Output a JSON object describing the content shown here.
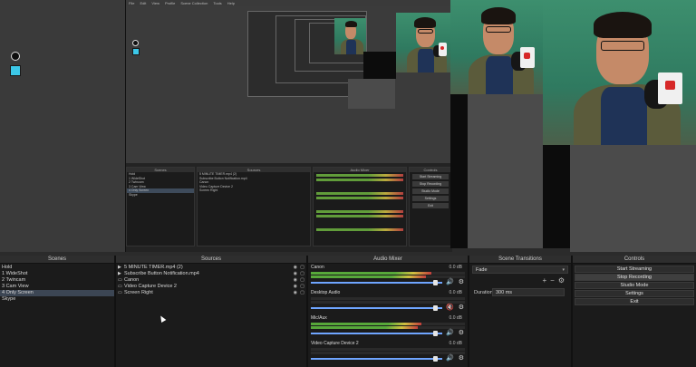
{
  "nested_menu": [
    "File",
    "Edit",
    "View",
    "Profile",
    "Scene Collection",
    "Tools",
    "Help"
  ],
  "nested_panels": {
    "scenes_title": "Scenes",
    "scenes": [
      "Hold",
      "1 WideShot",
      "2 Twincam",
      "3 Cam View",
      "4 Only Screen",
      "Skype"
    ],
    "sources_title": "Sources",
    "sources": [
      "5 MINUTE TIMER.mp4 (2)",
      "Subscribe Button Notification.mp4",
      "Canon",
      "Video Capture Device 2",
      "Screen Right"
    ],
    "mixer_title": "Audio Mixer",
    "transitions_title": "Scene Transitions",
    "controls_title": "Controls",
    "controls": [
      "Start Streaming",
      "Stop Recording",
      "Studio Mode",
      "Settings",
      "Exit"
    ]
  },
  "scenes_dock": {
    "title": "Scenes",
    "items": [
      "Hold",
      "1 WideShot",
      "2 Twincam",
      "3 Cam View",
      "4 Only Screen",
      "Skype"
    ],
    "selected_index": 4
  },
  "sources_dock": {
    "title": "Sources",
    "items": [
      {
        "label": "5 MINUTE TIMER.mp4 (2)",
        "icon": "play-icon"
      },
      {
        "label": "Subscribe Button Notification.mp4",
        "icon": "play-icon"
      },
      {
        "label": "Canon",
        "icon": "camera-icon"
      },
      {
        "label": "Video Capture Device 2",
        "icon": "camera-icon"
      },
      {
        "label": "Screen Right",
        "icon": "monitor-icon"
      }
    ]
  },
  "mixer_dock": {
    "title": "Audio Mixer",
    "channels": [
      {
        "name": "Canon",
        "db": "0.0 dB",
        "level": 0.78,
        "volume": 0.95,
        "muted": false
      },
      {
        "name": "Desktop Audio",
        "db": "0.0 dB",
        "level": 0.0,
        "volume": 0.95,
        "muted": true
      },
      {
        "name": "Mic/Aux",
        "db": "0.0 dB",
        "level": 0.72,
        "volume": 0.95,
        "muted": false
      },
      {
        "name": "Video Capture Device 2",
        "db": "0.0 dB",
        "level": 0.0,
        "volume": 0.95,
        "muted": false
      }
    ]
  },
  "transitions_dock": {
    "title": "Scene Transitions",
    "transition": "Fade",
    "duration_label": "Duration",
    "duration_value": "300 ms"
  },
  "controls_dock": {
    "title": "Controls",
    "buttons": [
      "Start Streaming",
      "Stop Recording",
      "Studio Mode",
      "Settings",
      "Exit"
    ],
    "active_index": 1
  },
  "colors": {
    "accent": "#3cc8e8",
    "meter_green": "#57a83a",
    "meter_yellow": "#d0c140",
    "meter_red": "#c23c3c",
    "slider_blue": "#6fa5ff",
    "mute_red": "#d63232"
  }
}
